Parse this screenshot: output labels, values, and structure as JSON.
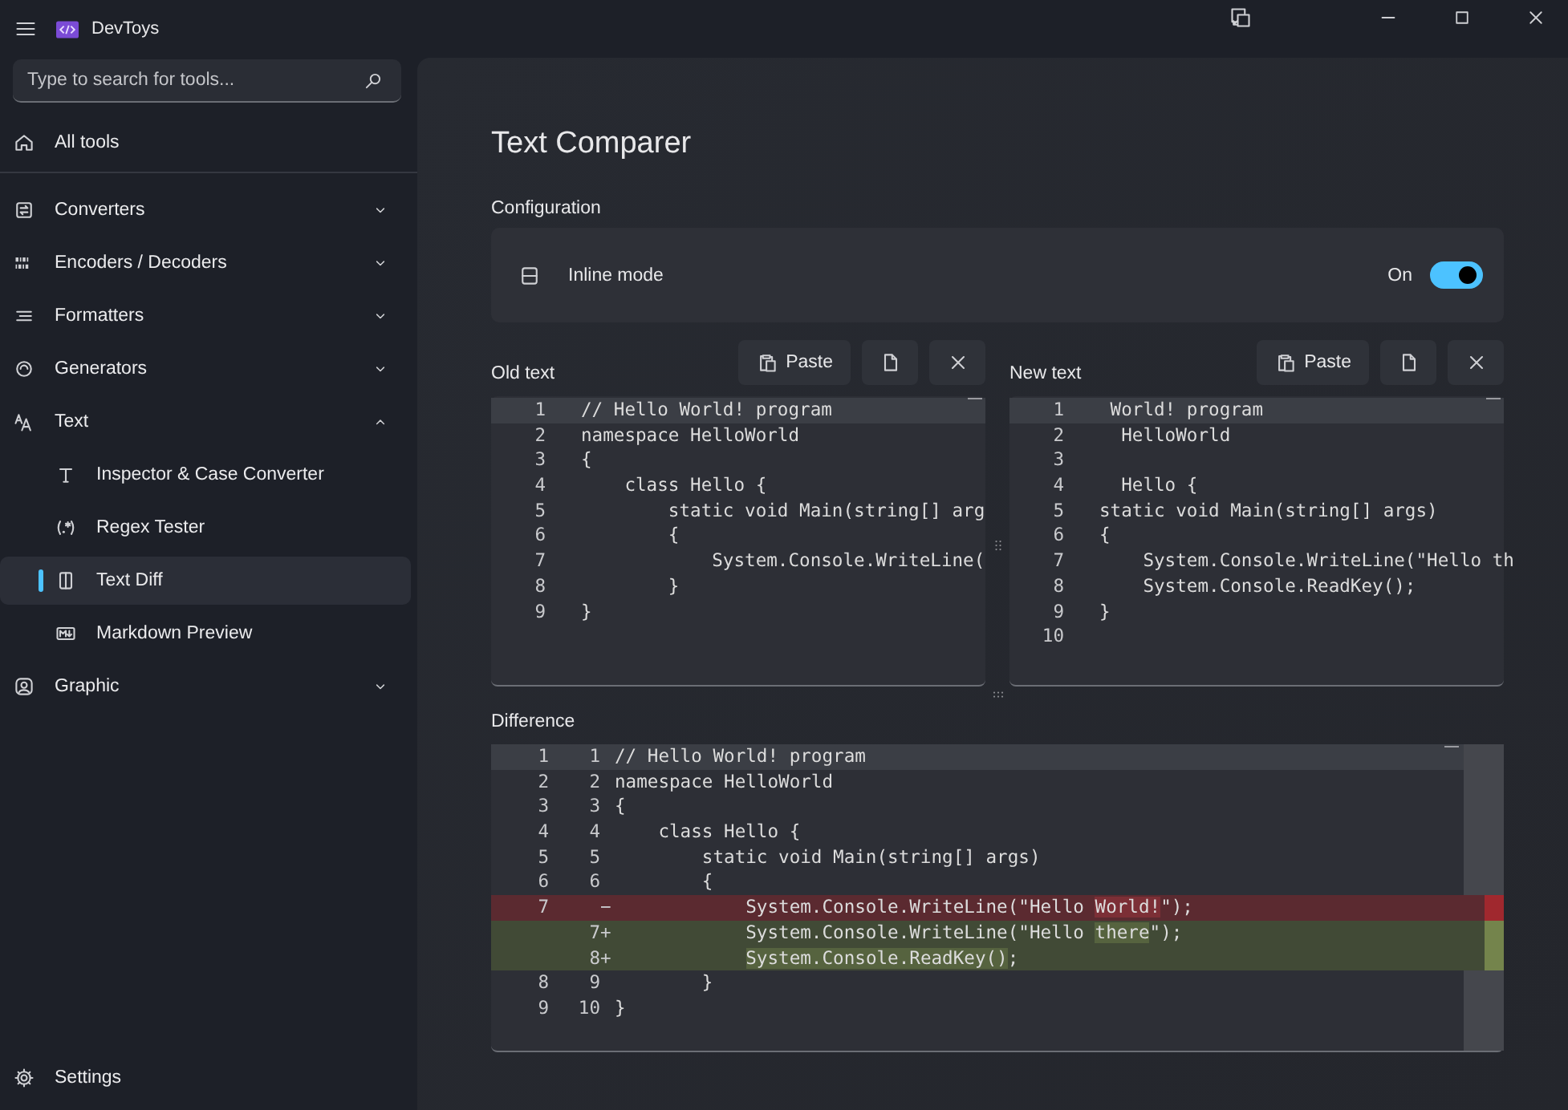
{
  "app": {
    "title": "DevToys"
  },
  "search": {
    "placeholder": "Type to search for tools..."
  },
  "nav": [
    {
      "label": "All tools",
      "kind": "link",
      "selected": false
    },
    {
      "label": "Converters",
      "kind": "group",
      "expanded": false,
      "selected": false
    },
    {
      "label": "Encoders / Decoders",
      "kind": "group",
      "expanded": false,
      "selected": false
    },
    {
      "label": "Formatters",
      "kind": "group",
      "expanded": false,
      "selected": false
    },
    {
      "label": "Generators",
      "kind": "group",
      "expanded": false,
      "selected": false
    },
    {
      "label": "Text",
      "kind": "group",
      "expanded": true,
      "selected": false,
      "children": [
        {
          "label": "Inspector & Case Converter",
          "selected": false
        },
        {
          "label": "Regex Tester",
          "selected": false
        },
        {
          "label": "Text Diff",
          "selected": true
        },
        {
          "label": "Markdown Preview",
          "selected": false
        }
      ]
    },
    {
      "label": "Graphic",
      "kind": "group",
      "expanded": false,
      "selected": false
    }
  ],
  "settings": {
    "label": "Settings"
  },
  "page": {
    "title": "Text Comparer",
    "config_label": "Configuration",
    "options": [
      {
        "label": "Inline mode",
        "state_text": "On",
        "on": true
      }
    ]
  },
  "editors": [
    {
      "label": "Old text",
      "buttons": [
        {
          "kind": "paste",
          "label": "Paste"
        },
        {
          "kind": "open"
        },
        {
          "kind": "clear"
        }
      ],
      "lines": [
        {
          "number": "1",
          "text": "// Hello World! program",
          "current": true
        },
        {
          "number": "2",
          "text": "namespace HelloWorld",
          "current": false
        },
        {
          "number": "3",
          "text": "{",
          "current": false
        },
        {
          "number": "4",
          "text": "    class Hello {",
          "current": false
        },
        {
          "number": "5",
          "text": "        static void Main(string[] arg",
          "current": false
        },
        {
          "number": "6",
          "text": "        {",
          "current": false
        },
        {
          "number": "7",
          "text": "            System.Console.WriteLine(",
          "current": false
        },
        {
          "number": "8",
          "text": "        }",
          "current": false
        },
        {
          "number": "9",
          "text": "}",
          "current": false
        }
      ]
    },
    {
      "label": "New text",
      "buttons": [
        {
          "kind": "paste",
          "label": "Paste"
        },
        {
          "kind": "open"
        },
        {
          "kind": "clear"
        }
      ],
      "lines": [
        {
          "number": "1",
          "text": " World! program",
          "current": true
        },
        {
          "number": "2",
          "text": "  HelloWorld",
          "current": false
        },
        {
          "number": "3",
          "current": false
        },
        {
          "number": "4",
          "text": "  Hello {",
          "current": false
        },
        {
          "number": "5",
          "text": "static void Main(string[] args)",
          "current": false
        },
        {
          "number": "6",
          "text": "{",
          "current": false
        },
        {
          "number": "7",
          "text": "    System.Console.WriteLine(\"Hello th",
          "current": false
        },
        {
          "number": "8",
          "text": "    System.Console.ReadKey();",
          "current": false
        },
        {
          "number": "9",
          "text": "}",
          "current": false
        },
        {
          "number": "10",
          "current": false
        }
      ]
    }
  ],
  "difference": {
    "label": "Difference",
    "rows": [
      {
        "kind": "same",
        "old": "1",
        "new": "1",
        "current": true,
        "segments": [
          {
            "text": "// Hello World! program",
            "changed": false
          }
        ]
      },
      {
        "kind": "same",
        "old": "2",
        "new": "2",
        "current": false,
        "segments": [
          {
            "text": "namespace HelloWorld",
            "changed": false
          }
        ]
      },
      {
        "kind": "same",
        "old": "3",
        "new": "3",
        "current": false,
        "segments": [
          {
            "text": "{",
            "changed": false
          }
        ]
      },
      {
        "kind": "same",
        "old": "4",
        "new": "4",
        "current": false,
        "segments": [
          {
            "text": "    class Hello {",
            "changed": false
          }
        ]
      },
      {
        "kind": "same",
        "old": "5",
        "new": "5",
        "current": false,
        "segments": [
          {
            "text": "        static void Main(string[] args)",
            "changed": false
          }
        ]
      },
      {
        "kind": "same",
        "old": "6",
        "new": "6",
        "current": false,
        "segments": [
          {
            "text": "        {",
            "changed": false
          }
        ]
      },
      {
        "kind": "removed",
        "old": "7",
        "marker": "−",
        "current": false,
        "segments": [
          {
            "text": "            System.Console.WriteLine(\"Hello ",
            "changed": false
          },
          {
            "text": "World!",
            "changed": true
          },
          {
            "text": "\");",
            "changed": false
          }
        ]
      },
      {
        "kind": "added",
        "new": "7",
        "marker": "+",
        "current": false,
        "segments": [
          {
            "text": "            System.Console.WriteLine(\"Hello ",
            "changed": false
          },
          {
            "text": "there",
            "changed": true
          },
          {
            "text": "\");",
            "changed": false
          }
        ]
      },
      {
        "kind": "added",
        "new": "8",
        "marker": "+",
        "current": false,
        "segments": [
          {
            "text": "            System.Console.ReadKey()",
            "changed": true
          },
          {
            "text": ";",
            "changed": false
          }
        ]
      },
      {
        "kind": "same",
        "old": "8",
        "new": "9",
        "current": false,
        "segments": [
          {
            "text": "        }",
            "changed": false
          }
        ]
      },
      {
        "kind": "same",
        "old": "9",
        "new": "10",
        "current": false,
        "segments": [
          {
            "text": "}",
            "changed": false
          }
        ]
      }
    ]
  }
}
